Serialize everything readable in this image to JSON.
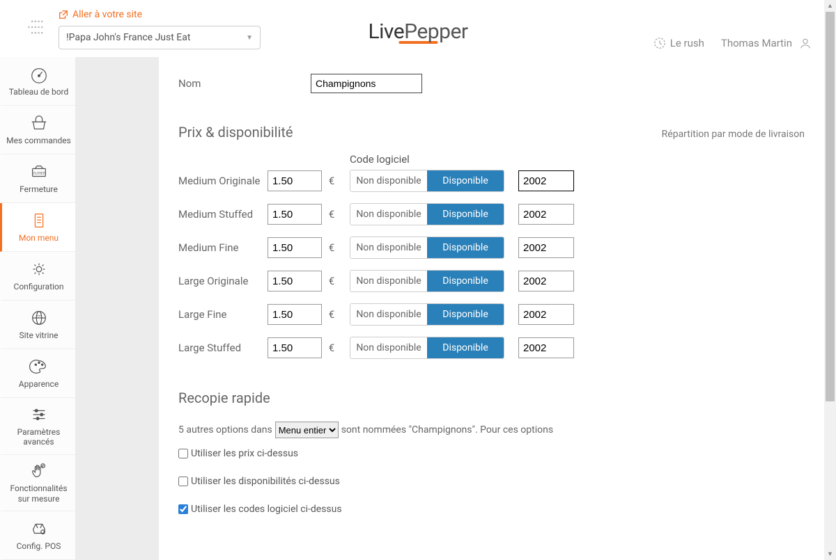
{
  "header": {
    "go_to_site": "Aller à votre site",
    "site_selector": "!Papa John's France Just Eat",
    "rush_label": "Le rush",
    "user_name": "Thomas Martin"
  },
  "logo": {
    "part1": "Live",
    "part2": "Pepper"
  },
  "sidebar": {
    "items": [
      {
        "label": "Tableau de bord",
        "icon": "dashboard"
      },
      {
        "label": "Mes commandes",
        "icon": "basket"
      },
      {
        "label": "Fermeture",
        "icon": "closed"
      },
      {
        "label": "Mon menu",
        "icon": "menu",
        "active": true
      },
      {
        "label": "Configuration",
        "icon": "gear"
      },
      {
        "label": "Site vitrine",
        "icon": "globe"
      },
      {
        "label": "Apparence",
        "icon": "palette"
      },
      {
        "label": "Paramètres avancés",
        "icon": "sliders"
      },
      {
        "label": "Fonctionnalités sur mesure",
        "icon": "hand"
      },
      {
        "label": "Config. POS",
        "icon": "pos"
      }
    ]
  },
  "form": {
    "name_label": "Nom",
    "name_value": "Champignons"
  },
  "pricing": {
    "title": "Prix & disponibilité",
    "breakdown_link": "Répartition par mode de livraison",
    "code_header": "Code logiciel",
    "currency": "€",
    "unavailable": "Non disponible",
    "available": "Disponible",
    "rows": [
      {
        "name": "Medium Originale",
        "price": "1.50",
        "code": "2002",
        "focused": true
      },
      {
        "name": "Medium Stuffed",
        "price": "1.50",
        "code": "2002"
      },
      {
        "name": "Medium Fine",
        "price": "1.50",
        "code": "2002"
      },
      {
        "name": "Large Originale",
        "price": "1.50",
        "code": "2002"
      },
      {
        "name": "Large Fine",
        "price": "1.50",
        "code": "2002"
      },
      {
        "name": "Large Stuffed",
        "price": "1.50",
        "code": "2002"
      }
    ]
  },
  "quick_copy": {
    "title": "Recopie rapide",
    "prefix": "5 autres options dans",
    "select_value": "Menu entier",
    "suffix": "sont nommées \"Champignons\". Pour ces options",
    "use_prices": "Utiliser les prix ci-dessus",
    "use_availability": "Utiliser les disponibilités ci-dessus",
    "use_codes": "Utiliser les codes logiciel ci-dessus"
  }
}
